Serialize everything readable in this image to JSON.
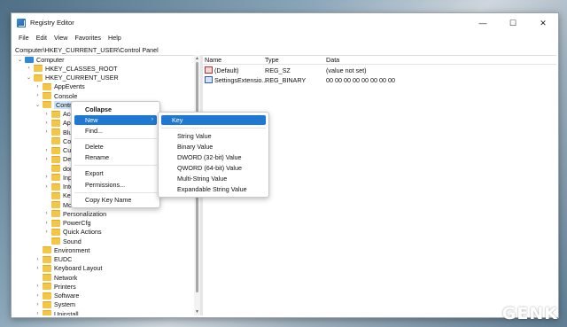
{
  "window": {
    "title": "Registry Editor",
    "controls": [
      "—",
      "☐",
      "✕"
    ]
  },
  "menubar": [
    "File",
    "Edit",
    "View",
    "Favorites",
    "Help"
  ],
  "address": "Computer\\HKEY_CURRENT_USER\\Control Panel",
  "tree": [
    {
      "label": "Computer",
      "indent": 0,
      "exp": "⌄",
      "icon": "pc"
    },
    {
      "label": "HKEY_CLASSES_ROOT",
      "indent": 1,
      "exp": "›",
      "icon": "folder"
    },
    {
      "label": "HKEY_CURRENT_USER",
      "indent": 1,
      "exp": "⌄",
      "icon": "folder"
    },
    {
      "label": "AppEvents",
      "indent": 2,
      "exp": "›",
      "icon": "folder"
    },
    {
      "label": "Console",
      "indent": 2,
      "exp": "›",
      "icon": "folder"
    },
    {
      "label": "Control Panel",
      "indent": 2,
      "exp": "⌄",
      "icon": "folder",
      "selected": true
    },
    {
      "label": "Acc",
      "indent": 3,
      "exp": "›",
      "icon": "folder"
    },
    {
      "label": "App",
      "indent": 3,
      "exp": "›",
      "icon": "folder"
    },
    {
      "label": "Blue",
      "indent": 3,
      "exp": "›",
      "icon": "folder"
    },
    {
      "label": "Colo",
      "indent": 3,
      "exp": "",
      "icon": "folder"
    },
    {
      "label": "Curs",
      "indent": 3,
      "exp": "›",
      "icon": "folder"
    },
    {
      "label": "Desk",
      "indent": 3,
      "exp": "›",
      "icon": "folder"
    },
    {
      "label": "don",
      "indent": 3,
      "exp": "",
      "icon": "folder"
    },
    {
      "label": "Inpu",
      "indent": 3,
      "exp": "›",
      "icon": "folder"
    },
    {
      "label": "Inte",
      "indent": 3,
      "exp": "›",
      "icon": "folder"
    },
    {
      "label": "Keyl",
      "indent": 3,
      "exp": "",
      "icon": "folder"
    },
    {
      "label": "Mou",
      "indent": 3,
      "exp": "",
      "icon": "folder"
    },
    {
      "label": "Personalization",
      "indent": 3,
      "exp": "›",
      "icon": "folder"
    },
    {
      "label": "PowerCfg",
      "indent": 3,
      "exp": "›",
      "icon": "folder"
    },
    {
      "label": "Quick Actions",
      "indent": 3,
      "exp": "›",
      "icon": "folder"
    },
    {
      "label": "Sound",
      "indent": 3,
      "exp": "",
      "icon": "folder"
    },
    {
      "label": "Environment",
      "indent": 2,
      "exp": "",
      "icon": "folder"
    },
    {
      "label": "EUDC",
      "indent": 2,
      "exp": "›",
      "icon": "folder"
    },
    {
      "label": "Keyboard Layout",
      "indent": 2,
      "exp": "›",
      "icon": "folder"
    },
    {
      "label": "Network",
      "indent": 2,
      "exp": "",
      "icon": "folder"
    },
    {
      "label": "Printers",
      "indent": 2,
      "exp": "›",
      "icon": "folder"
    },
    {
      "label": "Software",
      "indent": 2,
      "exp": "›",
      "icon": "folder"
    },
    {
      "label": "System",
      "indent": 2,
      "exp": "›",
      "icon": "folder"
    },
    {
      "label": "Uninstall",
      "indent": 2,
      "exp": "›",
      "icon": "folder"
    }
  ],
  "list": {
    "headers": {
      "name": "Name",
      "type": "Type",
      "data": "Data"
    },
    "rows": [
      {
        "name": "(Default)",
        "type": "REG_SZ",
        "data": "(value not set)",
        "icon": "string"
      },
      {
        "name": "SettingsExtensio...",
        "type": "REG_BINARY",
        "data": "00 00 00 00 00 00 00 00",
        "icon": "binary"
      }
    ]
  },
  "context_menu": {
    "items": [
      "Collapse",
      "New",
      "Find...",
      "Delete",
      "Rename",
      "Export",
      "Permissions...",
      "Copy Key Name"
    ]
  },
  "submenu": {
    "items": [
      "Key",
      "String Value",
      "Binary Value",
      "DWORD (32-bit) Value",
      "QWORD (64-bit) Value",
      "Multi-String Value",
      "Expandable String Value"
    ]
  },
  "watermark": "GENK"
}
